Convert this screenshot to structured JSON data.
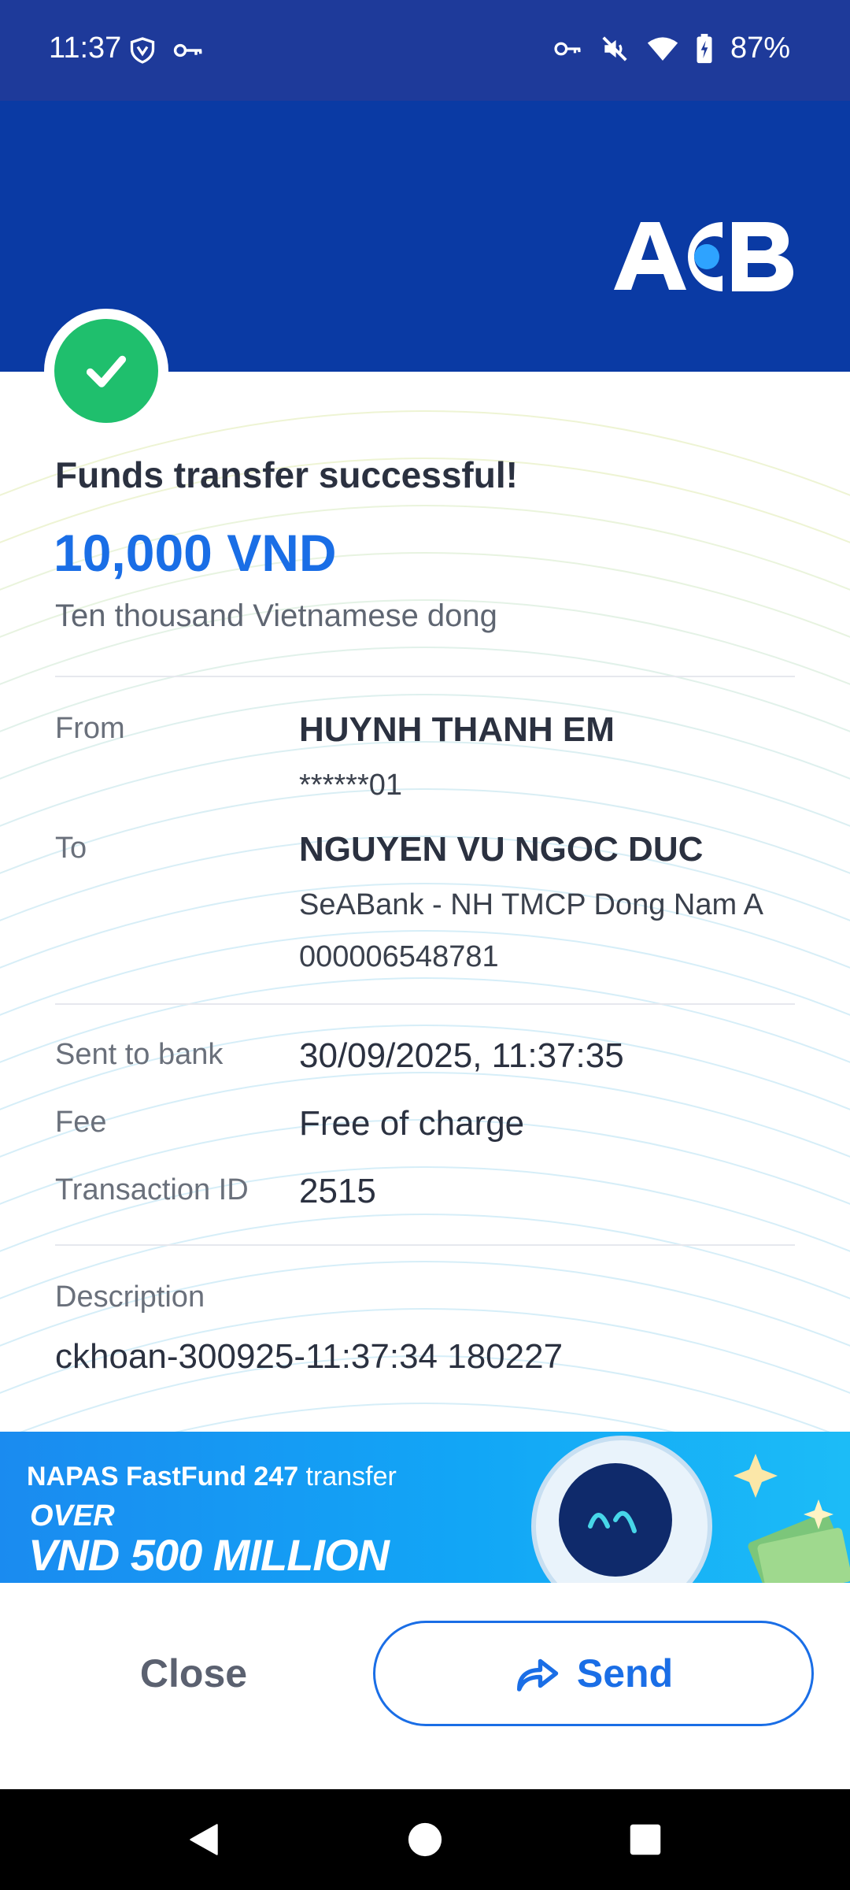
{
  "status_bar": {
    "time": "11:37",
    "battery": "87%",
    "icons_left": [
      "vpn-shield-icon",
      "key-icon"
    ],
    "icons_right": [
      "vpn-key-icon",
      "mute-icon",
      "wifi-icon",
      "battery-icon"
    ]
  },
  "header": {
    "logo_text": "ACB",
    "bg_color": "#0a3aa4"
  },
  "receipt": {
    "title": "Funds transfer successful!",
    "amount": "10,000 VND",
    "amount_words": "Ten thousand Vietnamese dong",
    "from_label": "From",
    "from_name": "HUYNH THANH EM",
    "from_account": "******01",
    "to_label": "To",
    "to_name": "NGUYEN VU NGOC DUC",
    "to_bank": "SeABank - NH TMCP Dong Nam A",
    "to_account": "000006548781",
    "sent_label": "Sent to bank",
    "sent_value": "30/09/2025, 11:37:35",
    "fee_label": "Fee",
    "fee_value": "Free of charge",
    "txn_label": "Transaction ID",
    "txn_value": "2515",
    "desc_label": "Description",
    "desc_value": "ckhoan-300925-11:37:34 180227",
    "success_color": "#1fbf6d",
    "amount_color": "#1a6ee6"
  },
  "banner": {
    "line1_bold": "NAPAS FastFund 247",
    "line1_rest": " transfer",
    "line2": "OVER",
    "line3": "VND 500 MILLION"
  },
  "actions": {
    "close_label": "Close",
    "send_label": "Send"
  }
}
